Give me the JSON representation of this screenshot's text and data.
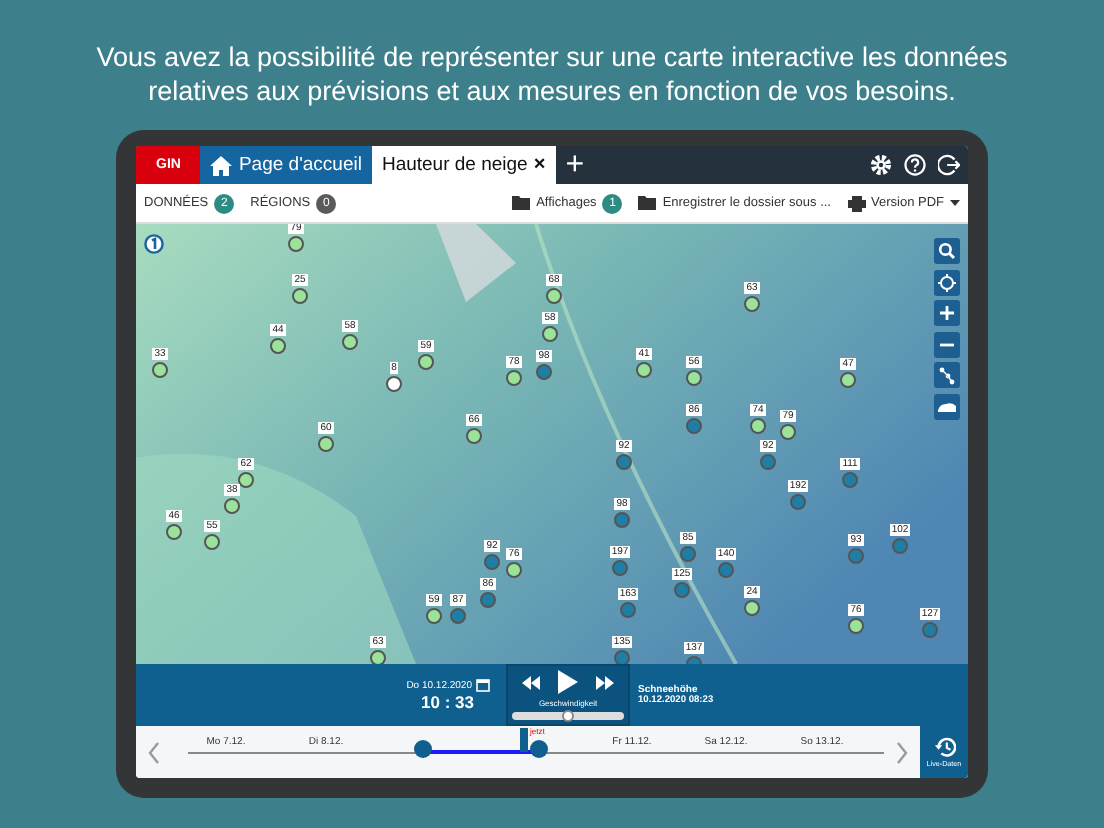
{
  "headline": "Vous avez la possibilité de représenter sur une carte interactive les données relatives aux prévisions et aux mesures en fonction de vos besoins.",
  "tabs": [
    {
      "label": "GIN",
      "kind": "brand",
      "selected": false
    },
    {
      "label": "Page d'accueil",
      "kind": "home",
      "selected": false
    },
    {
      "label": "Hauteur de neige",
      "kind": "doc",
      "selected": true
    }
  ],
  "add_tab": "+",
  "close_tab": "×",
  "toolbar": {
    "left": [
      {
        "label": "DONNÉES",
        "count": "2",
        "color": "#2e8b84"
      },
      {
        "label": "RÉGIONS",
        "count": "0",
        "color": "#5a5a5a"
      }
    ],
    "displays": {
      "label": "Affichages",
      "count": "1"
    },
    "save": "Enregistrer le dossier sous ...",
    "pdf": "Version PDF"
  },
  "markers": [
    {
      "label": "79",
      "color": "#9be39b"
    },
    {
      "label": "25",
      "color": "#9be39b"
    },
    {
      "label": "44",
      "color": "#9be39b"
    },
    {
      "label": "58",
      "color": "#9be39b"
    },
    {
      "label": "33",
      "color": "#9be39b"
    },
    {
      "label": "8",
      "color": "#ffffff"
    },
    {
      "label": "59",
      "color": "#9be39b"
    },
    {
      "label": "68",
      "color": "#9be39b"
    },
    {
      "label": "58",
      "color": "#9be39b"
    },
    {
      "label": "78",
      "color": "#9be39b"
    },
    {
      "label": "98",
      "color": "#1f7ea6"
    },
    {
      "label": "63",
      "color": "#9be39b"
    },
    {
      "label": "41",
      "color": "#9be39b"
    },
    {
      "label": "56",
      "color": "#9be39b"
    },
    {
      "label": "47",
      "color": "#9be39b"
    },
    {
      "label": "86",
      "color": "#1f7ea6"
    },
    {
      "label": "74",
      "color": "#9be39b"
    },
    {
      "label": "79",
      "color": "#9be39b"
    },
    {
      "label": "92",
      "color": "#1f7ea6"
    },
    {
      "label": "92",
      "color": "#1f7ea6"
    },
    {
      "label": "111",
      "color": "#1f7ea6"
    },
    {
      "label": "192",
      "color": "#1f7ea6"
    },
    {
      "label": "66",
      "color": "#9be39b"
    },
    {
      "label": "60",
      "color": "#9be39b"
    },
    {
      "label": "62",
      "color": "#9be39b"
    },
    {
      "label": "38",
      "color": "#9be39b"
    },
    {
      "label": "46",
      "color": "#9be39b"
    },
    {
      "label": "55",
      "color": "#9be39b"
    },
    {
      "label": "98",
      "color": "#1f7ea6"
    },
    {
      "label": "85",
      "color": "#1f7ea6"
    },
    {
      "label": "93",
      "color": "#1f7ea6"
    },
    {
      "label": "102",
      "color": "#1f7ea6"
    },
    {
      "label": "197",
      "color": "#1f7ea6"
    },
    {
      "label": "125",
      "color": "#1f7ea6"
    },
    {
      "label": "140",
      "color": "#1f7ea6"
    },
    {
      "label": "92",
      "color": "#1f7ea6"
    },
    {
      "label": "76",
      "color": "#9be39b"
    },
    {
      "label": "86",
      "color": "#1f7ea6"
    },
    {
      "label": "59",
      "color": "#9be39b"
    },
    {
      "label": "87",
      "color": "#1f7ea6"
    },
    {
      "label": "163",
      "color": "#1f7ea6"
    },
    {
      "label": "24",
      "color": "#9be39b"
    },
    {
      "label": "76",
      "color": "#9be39b"
    },
    {
      "label": "127",
      "color": "#1f7ea6"
    },
    {
      "label": "135",
      "color": "#1f7ea6"
    },
    {
      "label": "137",
      "color": "#1f7ea6"
    },
    {
      "label": "63",
      "color": "#9be39b"
    }
  ],
  "player": {
    "date": "Do 10.12.2020",
    "time": "10 : 33",
    "speed_label": "Geschwindigkeit",
    "speed": {
      "level": 0.5
    }
  },
  "layer": {
    "title": "Schneehöhe",
    "timestamp": "10.12.2020 08:23"
  },
  "timeline": {
    "days": [
      "Mo 7.12.",
      "Di 8.12.",
      "Fr 11.12.",
      "Sa 12.12.",
      "So 13.12."
    ],
    "now_label": "jetzt",
    "live_label": "Live-Daten"
  }
}
